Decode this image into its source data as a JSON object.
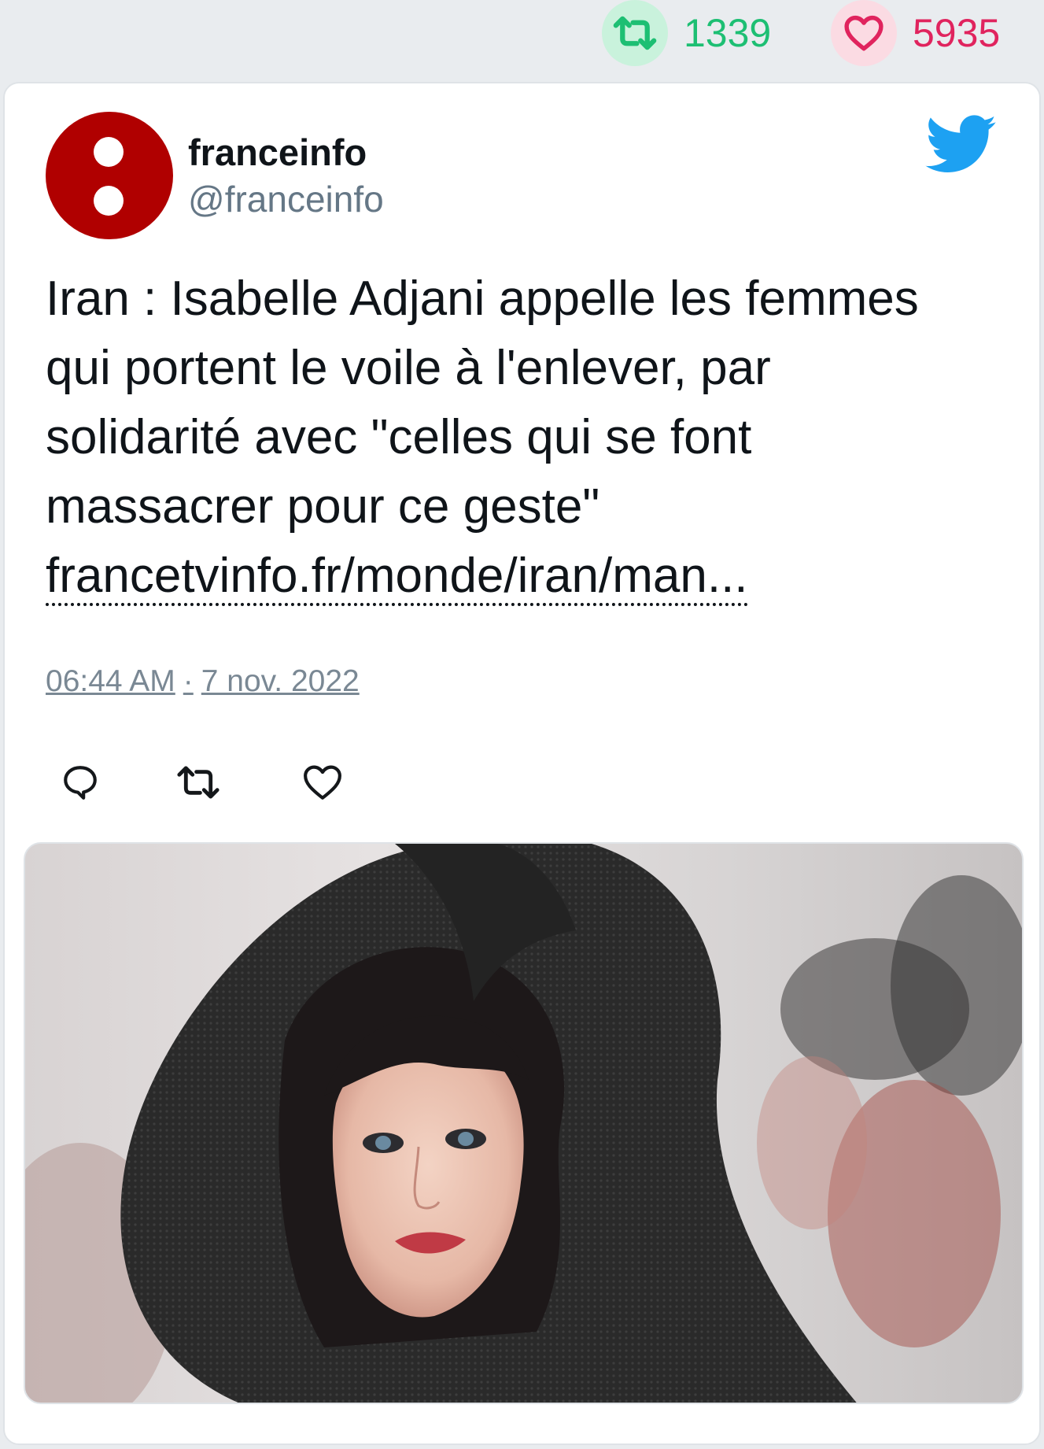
{
  "stats": {
    "retweets": "1339",
    "likes": "5935",
    "retweet_icon": "retweet-icon",
    "like_icon": "heart-icon",
    "retweet_color": "#1dbf73",
    "like_color": "#e0245e"
  },
  "tweet": {
    "author_name": "franceinfo",
    "author_handle": "@franceinfo",
    "avatar_color": "#b00000",
    "text_line1": "Iran : Isabelle Adjani appelle les femmes",
    "text_line2": "qui portent le voile à l'enlever, par",
    "text_line3": "solidarité avec \"celles qui se font",
    "text_line4": "massacrer pour ce geste\"",
    "link": "francetvinfo.fr/monde/iran/man...",
    "time": "06:44 AM",
    "date": "7 nov. 2022",
    "date_separator": "·",
    "brand_icon": "twitter-bird-icon",
    "brand_color": "#1da1f2"
  },
  "actions": [
    {
      "icon": "reply-icon"
    },
    {
      "icon": "retweet-icon"
    },
    {
      "icon": "heart-icon"
    }
  ],
  "media": {
    "type": "photo",
    "subject": "portrait of a woman in a large black woven hat"
  }
}
